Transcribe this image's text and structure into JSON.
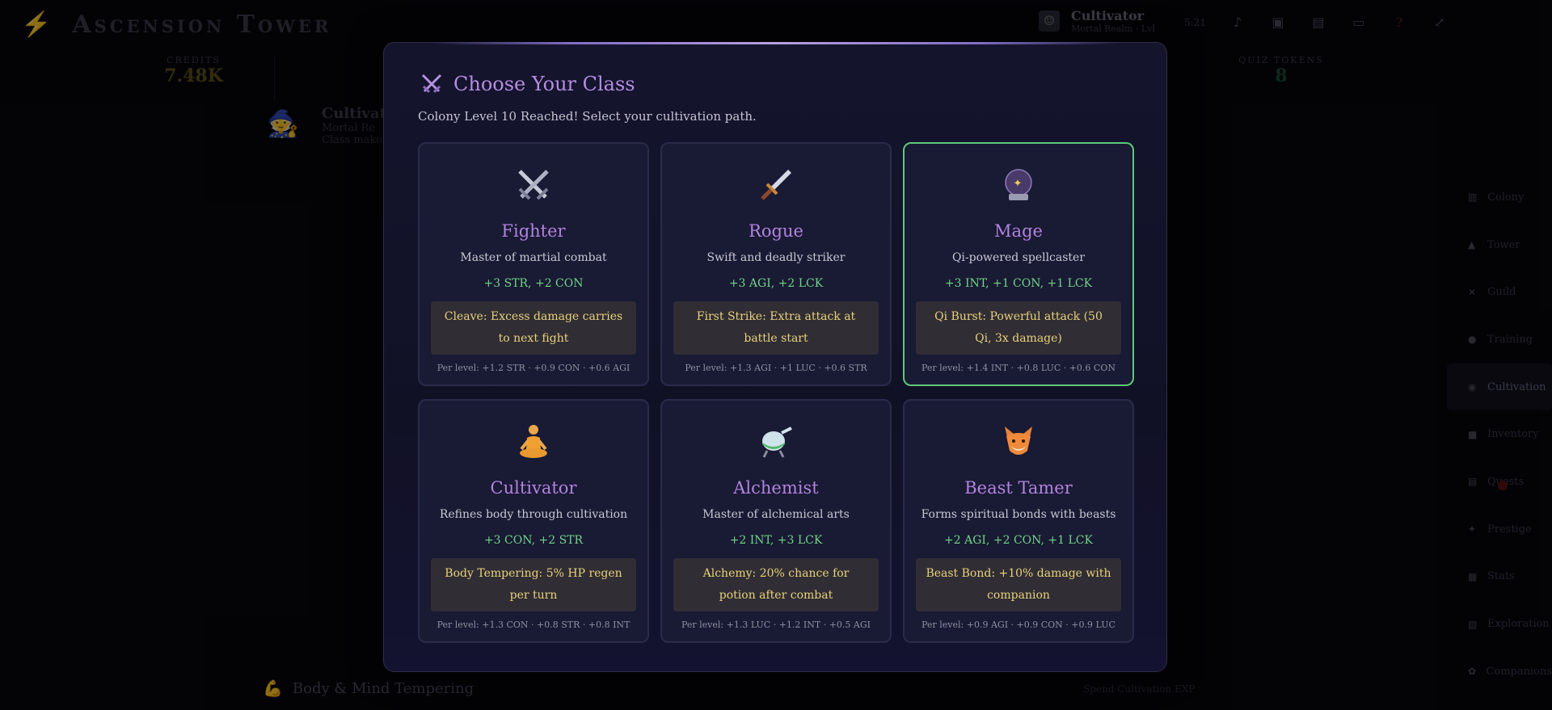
{
  "app": {
    "title": "Ascension Tower",
    "profile_name": "Cultivator",
    "profile_sub": "Mortal Realm · Lvl",
    "time": "5:21",
    "credits_label": "CREDITS",
    "credits_value": "7.48K",
    "tokens_label": "QUIZ TOKENS",
    "tokens_value": "8",
    "bg_card_title": "Cultivator",
    "bg_card_sub1": "Mortal Re",
    "bg_card_sub2": "Class make",
    "footer_title": "Body & Mind Tempering",
    "footer_right": "Spend Cultivation EXP"
  },
  "nav": [
    {
      "label": "Colony",
      "icon": "building-icon"
    },
    {
      "label": "Tower",
      "icon": "tower-icon"
    },
    {
      "label": "Guild",
      "icon": "swords-icon"
    },
    {
      "label": "Training",
      "icon": "muscle-icon"
    },
    {
      "label": "Cultivation",
      "icon": "orb-icon"
    },
    {
      "label": "Inventory",
      "icon": "bag-icon"
    },
    {
      "label": "Quests",
      "icon": "scroll-icon"
    },
    {
      "label": "Prestige",
      "icon": "sparkle-icon"
    },
    {
      "label": "Stats",
      "icon": "chart-icon"
    },
    {
      "label": "Exploration",
      "icon": "map-icon"
    },
    {
      "label": "Companions",
      "icon": "paw-icon"
    }
  ],
  "modal": {
    "title": "Choose Your Class",
    "subtitle": "Colony Level 10 Reached! Select your cultivation path.",
    "classes": [
      {
        "name": "Fighter",
        "icon": "crossed-swords-icon",
        "desc": "Master of martial combat",
        "stats": "+3 STR, +2 CON",
        "ability": "Cleave: Excess damage carries to next fight",
        "per_level": "Per level: +1.2 STR · +0.9 CON · +0.6 AGI",
        "selected": false
      },
      {
        "name": "Rogue",
        "icon": "dagger-icon",
        "desc": "Swift and deadly striker",
        "stats": "+3 AGI, +2 LCK",
        "ability": "First Strike: Extra attack at battle start",
        "per_level": "Per level: +1.3 AGI · +1 LUC · +0.6 STR",
        "selected": false
      },
      {
        "name": "Mage",
        "icon": "crystal-ball-icon",
        "desc": "Qi-powered spellcaster",
        "stats": "+3 INT, +1 CON, +1 LCK",
        "ability": "Qi Burst: Powerful attack (50 Qi, 3x damage)",
        "per_level": "Per level: +1.4 INT · +0.8 LUC · +0.6 CON",
        "selected": true
      },
      {
        "name": "Cultivator",
        "icon": "meditating-person-icon",
        "desc": "Refines body through cultivation",
        "stats": "+3 CON, +2 STR",
        "ability": "Body Tempering: 5% HP regen per turn",
        "per_level": "Per level: +1.3 CON · +0.8 STR · +0.8 INT",
        "selected": false
      },
      {
        "name": "Alchemist",
        "icon": "alembic-icon",
        "desc": "Master of alchemical arts",
        "stats": "+2 INT, +3 LCK",
        "ability": "Alchemy: 20% chance for potion after combat",
        "per_level": "Per level: +1.3 LUC · +1.2 INT · +0.5 AGI",
        "selected": false
      },
      {
        "name": "Beast Tamer",
        "icon": "fox-icon",
        "desc": "Forms spiritual bonds with beasts",
        "stats": "+2 AGI, +2 CON, +1 LCK",
        "ability": "Beast Bond: +10% damage with companion",
        "per_level": "Per level: +0.9 AGI · +0.9 CON · +0.9 LUC",
        "selected": false
      }
    ]
  }
}
